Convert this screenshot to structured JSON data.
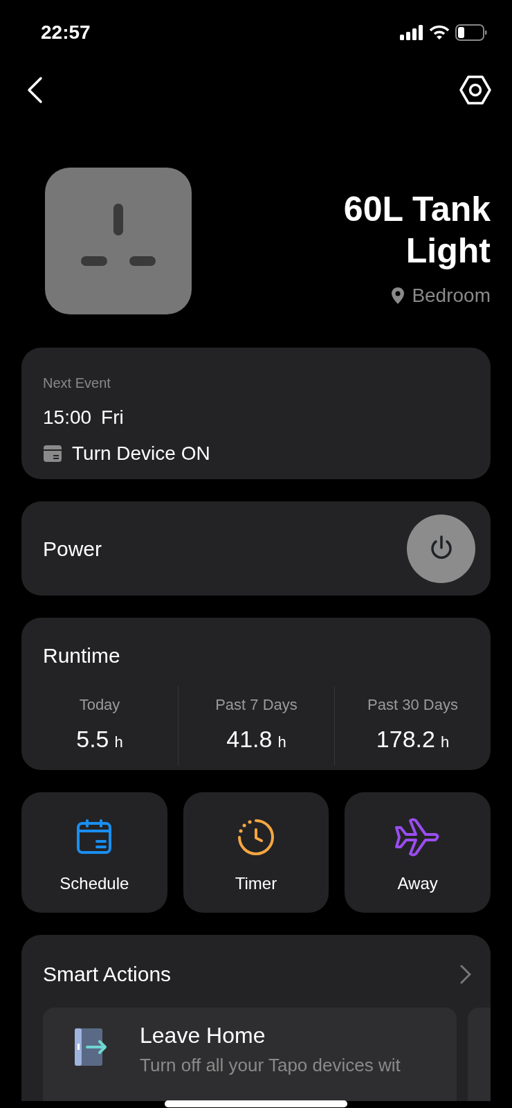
{
  "status_bar": {
    "time": "22:57"
  },
  "device": {
    "name": "60L Tank Light",
    "room": "Bedroom"
  },
  "next_event": {
    "label": "Next Event",
    "time": "15:00",
    "day": "Fri",
    "action": "Turn Device ON"
  },
  "power": {
    "label": "Power",
    "on": false
  },
  "runtime": {
    "title": "Runtime",
    "stats": [
      {
        "label": "Today",
        "value": "5.5",
        "unit": "h"
      },
      {
        "label": "Past 7 Days",
        "value": "41.8",
        "unit": "h"
      },
      {
        "label": "Past 30 Days",
        "value": "178.2",
        "unit": "h"
      }
    ]
  },
  "shortcuts": [
    {
      "kind": "schedule",
      "label": "Schedule",
      "color": "#1a8ff0"
    },
    {
      "kind": "timer",
      "label": "Timer",
      "color": "#f5a742"
    },
    {
      "kind": "away",
      "label": "Away",
      "color": "#9b4df0"
    }
  ],
  "smart_actions": {
    "title": "Smart Actions",
    "cards": [
      {
        "title": "Leave Home",
        "description": "Turn off all your Tapo devices wit"
      }
    ]
  }
}
